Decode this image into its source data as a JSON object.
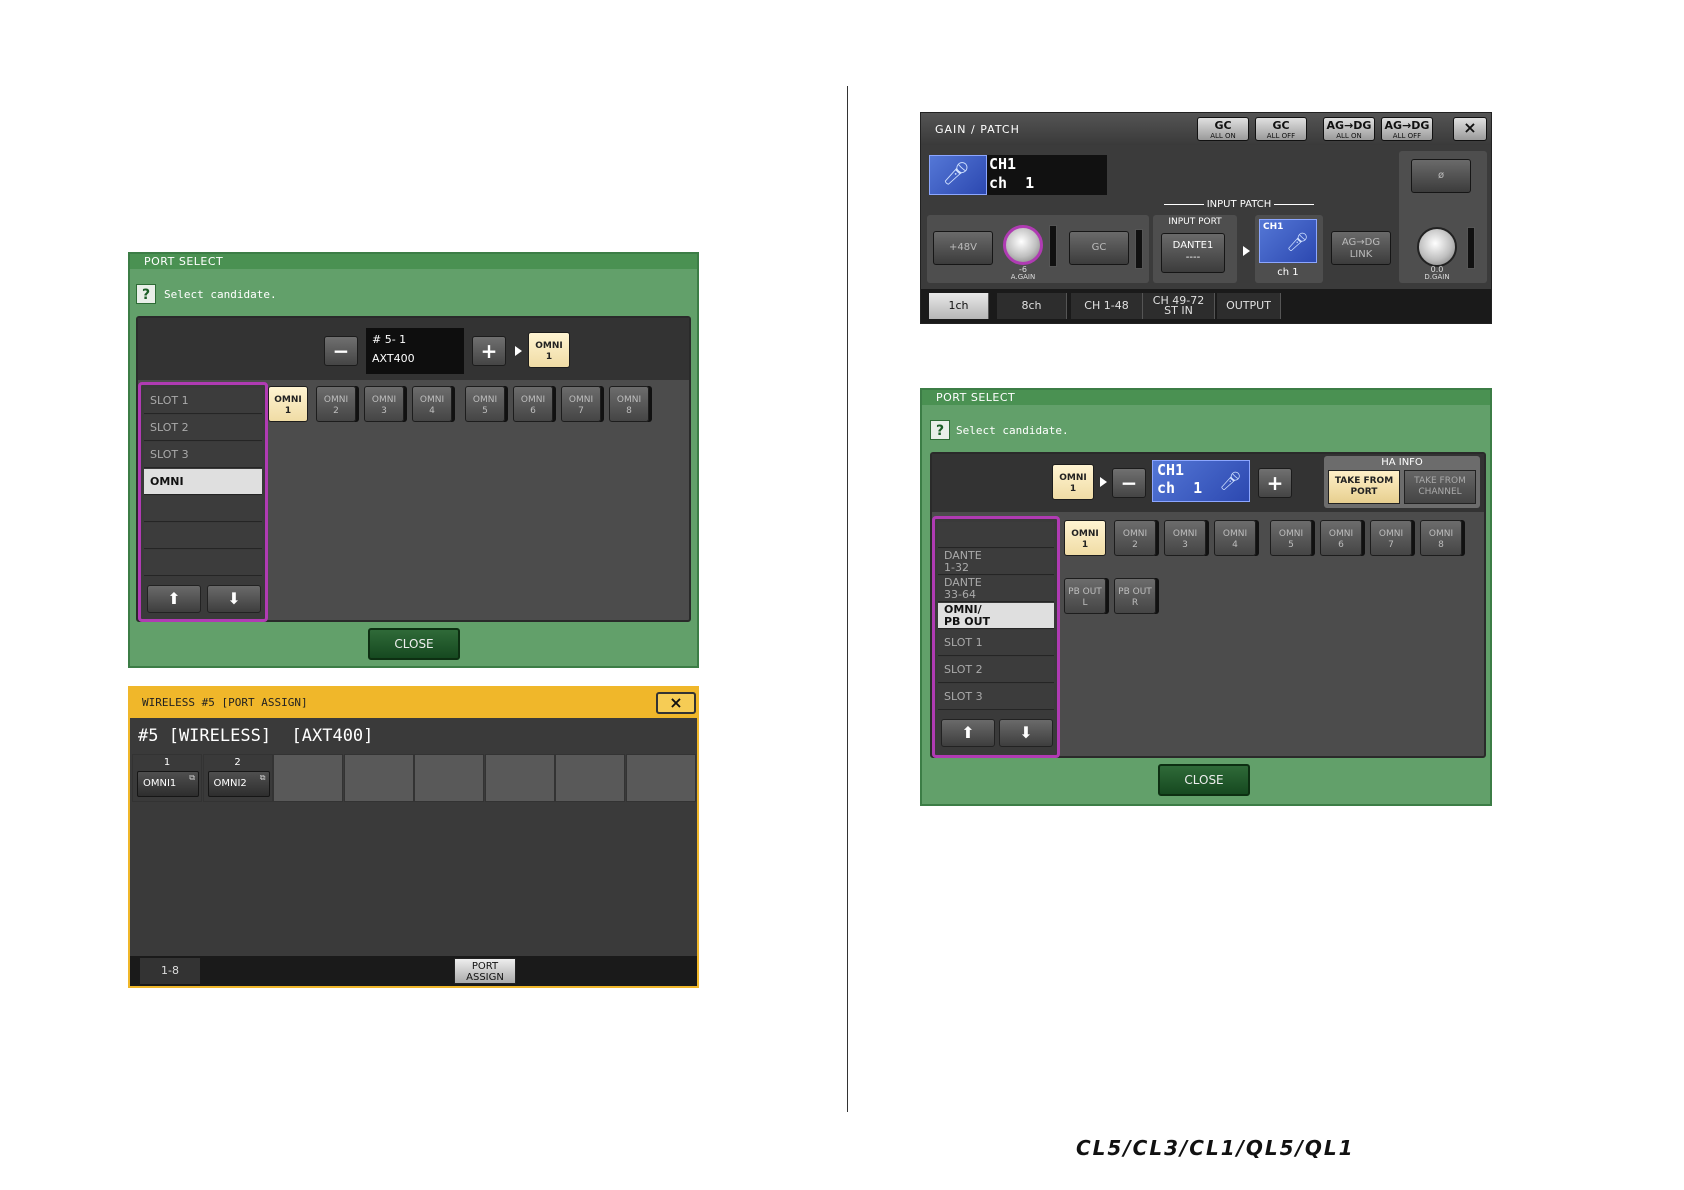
{
  "port_select_1": {
    "title": "PORT SELECT",
    "prompt": "Select candidate.",
    "source_name": "# 5- 1",
    "source_model": "AXT400",
    "target_port": {
      "l1": "OMNI",
      "l2": "1"
    },
    "list": [
      "SLOT 1",
      "SLOT 2",
      "SLOT 3",
      "OMNI",
      "",
      "",
      ""
    ],
    "ports": [
      {
        "l1": "OMNI",
        "l2": "1"
      },
      {
        "l1": "OMNI",
        "l2": "2"
      },
      {
        "l1": "OMNI",
        "l2": "3"
      },
      {
        "l1": "OMNI",
        "l2": "4"
      },
      {
        "l1": "OMNI",
        "l2": "5"
      },
      {
        "l1": "OMNI",
        "l2": "6"
      },
      {
        "l1": "OMNI",
        "l2": "7"
      },
      {
        "l1": "OMNI",
        "l2": "8"
      }
    ],
    "close_label": "CLOSE"
  },
  "wireless": {
    "title": "WIRELESS #5 [PORT ASSIGN]",
    "close_symbol": "×",
    "heading": "#5 [WIRELESS]  [AXT400]",
    "cells": [
      {
        "num": "1",
        "port": "OMNI1"
      },
      {
        "num": "2",
        "port": "OMNI2"
      }
    ],
    "tab": "1-8",
    "port_assign": {
      "l1": "PORT",
      "l2": "ASSIGN"
    }
  },
  "gain_patch": {
    "title": "GAIN / PATCH",
    "top_buttons": [
      {
        "l1": "GC",
        "l2": "ALL ON"
      },
      {
        "l1": "GC",
        "l2": "ALL OFF"
      },
      {
        "l1": "AG→DG",
        "l2": "ALL ON"
      },
      {
        "l1": "AG→DG",
        "l2": "ALL OFF"
      }
    ],
    "close_symbol": "×",
    "ch_line1": "CH1",
    "ch_line2": "ch  1",
    "phantom": "+48V",
    "again_value": "-6",
    "again_label": "A.GAIN",
    "gc": "GC",
    "input_patch": "INPUT PATCH",
    "input_port": "INPUT PORT",
    "port_name": "DANTE1",
    "port_sub": "----",
    "patch_ch": "CH1",
    "patch_name": "ch 1",
    "link_l1": "AG→DG",
    "link_l2": "LINK",
    "phase": "ø",
    "dgain_value": "0.0",
    "dgain_label": "D.GAIN",
    "tabs": [
      {
        "l1": "1ch",
        "l2": ""
      },
      {
        "l1": "8ch",
        "l2": ""
      },
      {
        "l1": "CH 1-48",
        "l2": ""
      },
      {
        "l1": "CH 49-72",
        "l2": "ST IN"
      },
      {
        "l1": "OUTPUT",
        "l2": ""
      }
    ]
  },
  "port_select_2": {
    "title": "PORT SELECT",
    "prompt": "Select candidate.",
    "source_port": {
      "l1": "OMNI",
      "l2": "1"
    },
    "ch_line1": "CH1",
    "ch_line2": "ch  1",
    "ha_info": "HA INFO",
    "take_port": {
      "l1": "TAKE FROM",
      "l2": "PORT"
    },
    "take_channel": {
      "l1": "TAKE FROM",
      "l2": "CHANNEL"
    },
    "list": [
      {
        "l1": "",
        "l2": ""
      },
      {
        "l1": "DANTE",
        "l2": "1-32"
      },
      {
        "l1": "DANTE",
        "l2": "33-64"
      },
      {
        "l1": "OMNI/",
        "l2": "PB OUT"
      },
      {
        "l1": "SLOT 1",
        "l2": ""
      },
      {
        "l1": "SLOT 2",
        "l2": ""
      },
      {
        "l1": "SLOT 3",
        "l2": ""
      }
    ],
    "ports": [
      {
        "l1": "OMNI",
        "l2": "1"
      },
      {
        "l1": "OMNI",
        "l2": "2"
      },
      {
        "l1": "OMNI",
        "l2": "3"
      },
      {
        "l1": "OMNI",
        "l2": "4"
      },
      {
        "l1": "OMNI",
        "l2": "5"
      },
      {
        "l1": "OMNI",
        "l2": "6"
      },
      {
        "l1": "OMNI",
        "l2": "7"
      },
      {
        "l1": "OMNI",
        "l2": "8"
      }
    ],
    "pb_ports": [
      {
        "l1": "PB OUT",
        "l2": "L"
      },
      {
        "l1": "PB OUT",
        "l2": "R"
      }
    ],
    "close_label": "CLOSE"
  },
  "footer_logo": "CL5/CL3/CL1/QL5/QL1",
  "colors": {
    "green_frame": "#62a06a",
    "magenta_outline": "#b03bb3",
    "wireless_yellow": "#f0b72a",
    "selected_port": "#f0dca5",
    "mic_blue": "#3b5cc4"
  }
}
